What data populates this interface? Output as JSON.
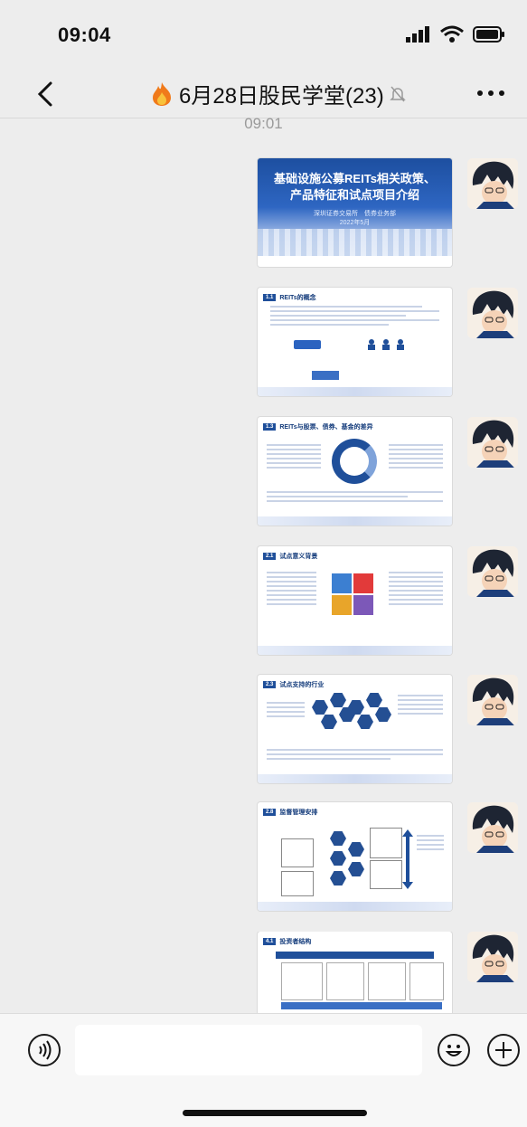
{
  "status_bar": {
    "time": "09:04"
  },
  "chat": {
    "title": "6月28日股民学堂(23)",
    "timestamp": "09:01"
  },
  "messages": [
    {
      "type": "slide",
      "title_lines": [
        "基础设施公募REITs相关政策、",
        "产品特征和试点项目介绍"
      ],
      "subtitle": "深圳证券交易所　债券业务部",
      "date": "2022年5月"
    },
    {
      "type": "slide",
      "num": "1.1",
      "title": "REITs的概念"
    },
    {
      "type": "slide",
      "num": "1.3",
      "title": "REITs与股票、债券、基金的差异"
    },
    {
      "type": "slide",
      "num": "2.1",
      "title": "试点意义背景"
    },
    {
      "type": "slide",
      "num": "2.3",
      "title": "试点支持的行业"
    },
    {
      "type": "slide",
      "num": "2.8",
      "title": "监督管理安排"
    },
    {
      "type": "slide",
      "num": "4.1",
      "title": "投资者结构"
    }
  ],
  "colors": {
    "accent": "#1f4f9a",
    "background": "#ededed"
  },
  "icons": [
    "fire-icon",
    "mute-icon",
    "voice-icon",
    "emoji-icon",
    "add-icon"
  ]
}
